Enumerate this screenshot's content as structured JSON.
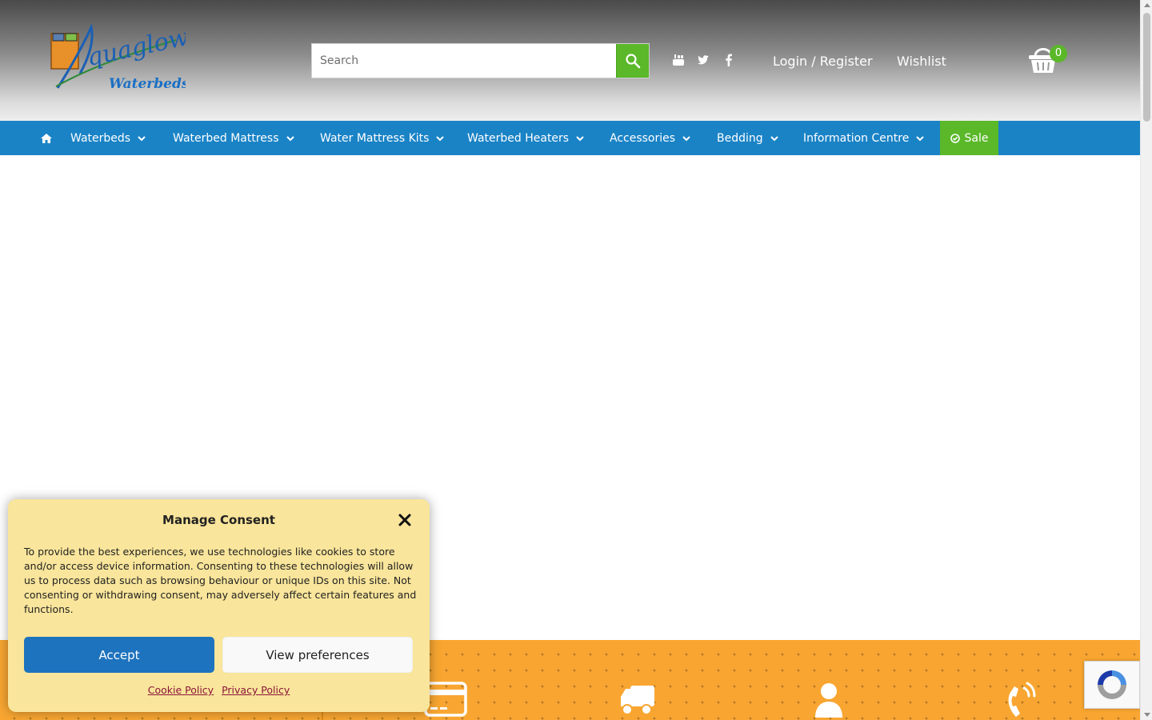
{
  "brand": {
    "logo_text_top": "Aquaglow",
    "logo_text_bottom": "Waterbeds"
  },
  "search": {
    "placeholder": "Search"
  },
  "header": {
    "social_icons": [
      "youtube-icon",
      "twitter-icon",
      "facebook-icon"
    ],
    "login_label": "Login / Register",
    "wishlist_label": "Wishlist",
    "cart_count": "0"
  },
  "nav": {
    "items": [
      {
        "label": "Waterbeds"
      },
      {
        "label": "Waterbed Mattress"
      },
      {
        "label": "Water Mattress Kits"
      },
      {
        "label": "Waterbed Heaters"
      },
      {
        "label": "Accessories"
      },
      {
        "label": "Bedding"
      },
      {
        "label": "Information Centre"
      }
    ],
    "sale_label": "Sale"
  },
  "consent": {
    "title": "Manage Consent",
    "body": "To provide the best experiences, we use technologies like cookies to store and/or access device information. Consenting to these technologies will allow us to process data such as browsing behaviour or unique IDs on this site. Not consenting or withdrawing consent, may adversely affect certain features and functions.",
    "accept_label": "Accept",
    "preferences_label": "View preferences",
    "cookie_policy_label": "Cookie Policy",
    "privacy_policy_label": "Privacy Policy"
  },
  "footer_band_icons": [
    "credit-card-icon",
    "delivery-truck-icon",
    "user-icon",
    "phone-icon"
  ],
  "colors": {
    "nav_blue": "#1a83c6",
    "accent_green": "#5ab829",
    "band_orange": "#f8a631",
    "consent_bg": "#f9e59b",
    "accept_blue": "#1e73be",
    "policy_link": "#8a1538"
  }
}
